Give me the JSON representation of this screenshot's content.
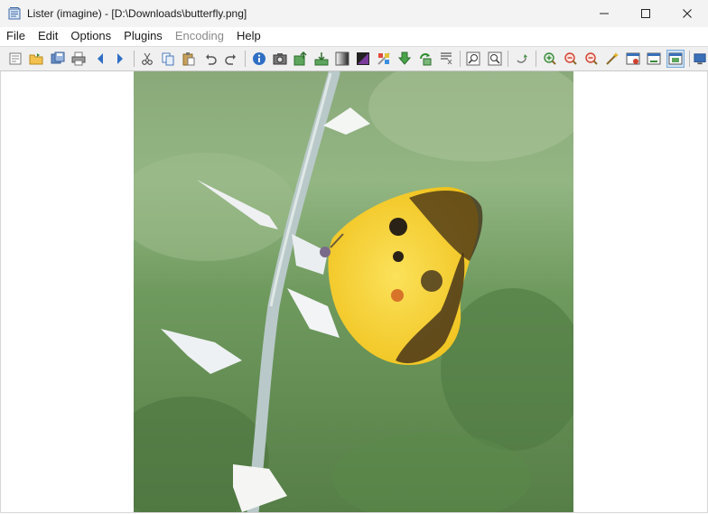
{
  "window": {
    "title": "Lister (imagine) - [D:\\Downloads\\butterfly.png]",
    "controls": [
      "minimize-icon",
      "maximize-icon",
      "close-icon"
    ]
  },
  "menu": {
    "items": [
      {
        "label": "File",
        "enabled": true
      },
      {
        "label": "Edit",
        "enabled": true
      },
      {
        "label": "Options",
        "enabled": true
      },
      {
        "label": "Plugins",
        "enabled": true
      },
      {
        "label": "Encoding",
        "enabled": false
      },
      {
        "label": "Help",
        "enabled": true
      }
    ]
  },
  "toolbar": {
    "icons": [
      "properties-icon",
      "open-icon",
      "save-as-icon",
      "print-icon",
      "previous-icon",
      "next-icon",
      "cut-icon",
      "copy-icon",
      "paste-icon",
      "undo-icon",
      "redo-icon",
      "info-icon",
      "slideshow-icon",
      "export-icon",
      "import-icon",
      "grayscale-icon",
      "negative-icon",
      "color-adjust-icon",
      "download-icon",
      "rotate-icon",
      "effects-icon",
      "zoom-in-fit-icon",
      "zoom-out-fit-icon",
      "refresh-icon",
      "zoom-in-icon",
      "zoom-out-icon",
      "zoom-reset-icon",
      "magic-wand-icon",
      "fit-window-icon",
      "fit-width-icon",
      "fit-best-icon",
      "fullscreen-icon"
    ],
    "pressed": "fit-best-icon",
    "accent": "#2f6fc4"
  },
  "image": {
    "file": "butterfly.png",
    "subject": "yellow-butterfly-on-white-flower-stem",
    "colors": {
      "background": "#6f9a5e",
      "butterfly": "#f5d12a",
      "spots": "#2a2216"
    }
  }
}
